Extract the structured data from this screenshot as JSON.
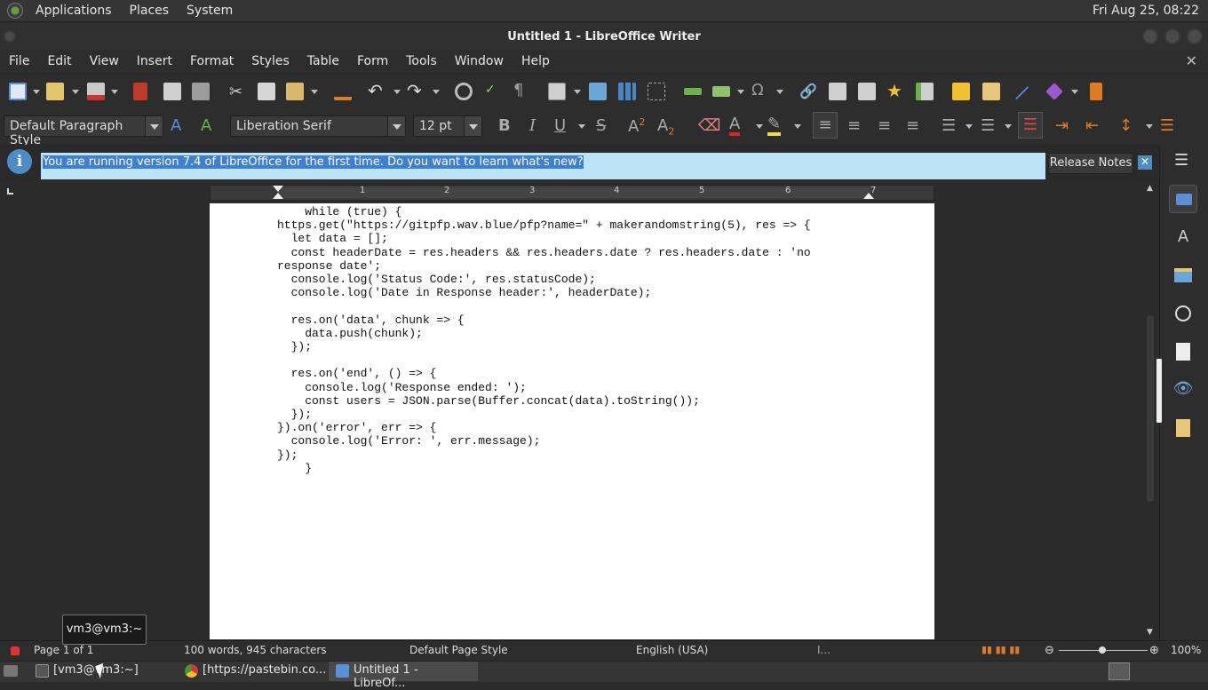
{
  "top_panel": {
    "menus": [
      "Applications",
      "Places",
      "System"
    ],
    "clock": "Fri Aug 25, 08:22"
  },
  "window": {
    "title": "Untitled 1 - LibreOffice Writer"
  },
  "menubar": {
    "items": [
      "File",
      "Edit",
      "View",
      "Insert",
      "Format",
      "Styles",
      "Table",
      "Form",
      "Tools",
      "Window",
      "Help"
    ],
    "close_doc": "✕"
  },
  "formatting": {
    "paragraph_style": "Default Paragraph Style",
    "font_name": "Liberation Serif",
    "font_size": "12 pt"
  },
  "infobar": {
    "icon": "i",
    "message": "You are running version 7.4 of LibreOffice for the first time. Do you want to learn what's new?",
    "release_notes_label": "Release Notes",
    "close": "✕"
  },
  "ruler": {
    "numbers": [
      "1",
      "2",
      "3",
      "4",
      "5",
      "6",
      "7"
    ]
  },
  "document": {
    "code": "    while (true) {\nhttps.get(\"https://gitpfp.wav.blue/pfp?name=\" + makerandomstring(5), res => {\n  let data = [];\n  const headerDate = res.headers && res.headers.date ? res.headers.date : 'no\nresponse date';\n  console.log('Status Code:', res.statusCode);\n  console.log('Date in Response header:', headerDate);\n\n  res.on('data', chunk => {\n    data.push(chunk);\n  });\n\n  res.on('end', () => {\n    console.log('Response ended: ');\n    const users = JSON.parse(Buffer.concat(data).toString());\n  });\n}).on('error', err => {\n  console.log('Error: ', err.message);\n});\n    }"
  },
  "statusbar": {
    "page": "Page 1 of 1",
    "word_count": "100 words, 945 characters",
    "page_style": "Default Page Style",
    "language": "English (USA)",
    "zoom": "100%"
  },
  "taskbar": {
    "tasks": [
      "[vm3@vm3:~]",
      "[https://pastebin.co...",
      "Untitled 1 - LibreOf..."
    ]
  },
  "tooltip": "vm3@vm3:~",
  "colors": {
    "info_bg": "#bde3f6",
    "info_highlight": "#3d7fd0",
    "accent_blue": "#4e8cc7"
  }
}
